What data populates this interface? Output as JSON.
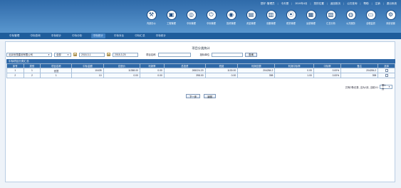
{
  "header": {
    "links": [
      "您好: 管理员",
      "今天是",
      "2019年4月",
      "您的位置",
      "返回首页",
      "公共查询",
      "帮助",
      "注销",
      "退出系统"
    ],
    "icons": [
      {
        "name": "internal-office-icon",
        "glyph": "⚒",
        "label": "内部办公"
      },
      {
        "name": "project-management-icon",
        "glyph": "▣",
        "label": "工程管理"
      },
      {
        "name": "bidding-management-icon",
        "glyph": "◎",
        "label": "中标管理"
      },
      {
        "name": "power-icon",
        "glyph": "⏻",
        "label": "中标管理"
      },
      {
        "name": "target-icon",
        "glyph": "◉",
        "label": "投资管理"
      },
      {
        "name": "document-icon",
        "glyph": "▤",
        "label": "资金管理"
      },
      {
        "name": "book-icon",
        "glyph": "▥",
        "label": "设备管理"
      },
      {
        "name": "record-icon",
        "glyph": "⦿",
        "label": "税务管理"
      },
      {
        "name": "report-icon",
        "glyph": "▦",
        "label": "运营管理"
      },
      {
        "name": "chart-icon",
        "glyph": "▧",
        "label": "汇总分析"
      },
      {
        "name": "globe-icon",
        "glyph": "◍",
        "label": "公共服务"
      },
      {
        "name": "monitor-icon",
        "glyph": "▭",
        "label": "全程监督"
      },
      {
        "name": "settings-icon",
        "glyph": "⚙",
        "label": "系统设置"
      }
    ]
  },
  "nav": {
    "items": [
      "中标管理",
      "中标查询",
      "中标统计",
      "中标分析",
      "中标统计",
      "中标对比",
      "中标汇总",
      "中标统计"
    ],
    "active_index": 4
  },
  "page": {
    "title": "项目分类统计"
  },
  "filters": {
    "company_value": "北京世茂建设有限公司",
    "type_value": "全部",
    "date_from": "2018-3-1",
    "date_to": "2018-3-25",
    "project_name_label": "项目名称",
    "bid_unit_label": "投标单位",
    "search_button": "查询"
  },
  "table": {
    "panel_title": "中标项目分类汇总",
    "headers": [
      "序号",
      "类别",
      "项目名称",
      "中标金额",
      "总造价",
      "利润率",
      "总投资",
      "税费",
      "利润总额",
      "利润中标率",
      "中标率",
      "备注",
      "选择"
    ],
    "rows": [
      [
        "1",
        "1",
        "世茂",
        "10435",
        "11358.00",
        "0.00",
        "265224.20",
        "1130.00",
        "204284.2",
        "0.00",
        "0.00%",
        "204284.2",
        ""
      ],
      [
        "2",
        "2",
        "1",
        "10",
        "0.00",
        "0.00",
        "398.00",
        "0.00",
        "398",
        "1.00",
        "0.00%",
        "398",
        ""
      ]
    ]
  },
  "pager": {
    "summary": "共有2条记录, 当为1页, 当前1/1",
    "page_value": "第1页"
  },
  "actions": {
    "next_button": "下一步",
    "back_button": "返回"
  }
}
